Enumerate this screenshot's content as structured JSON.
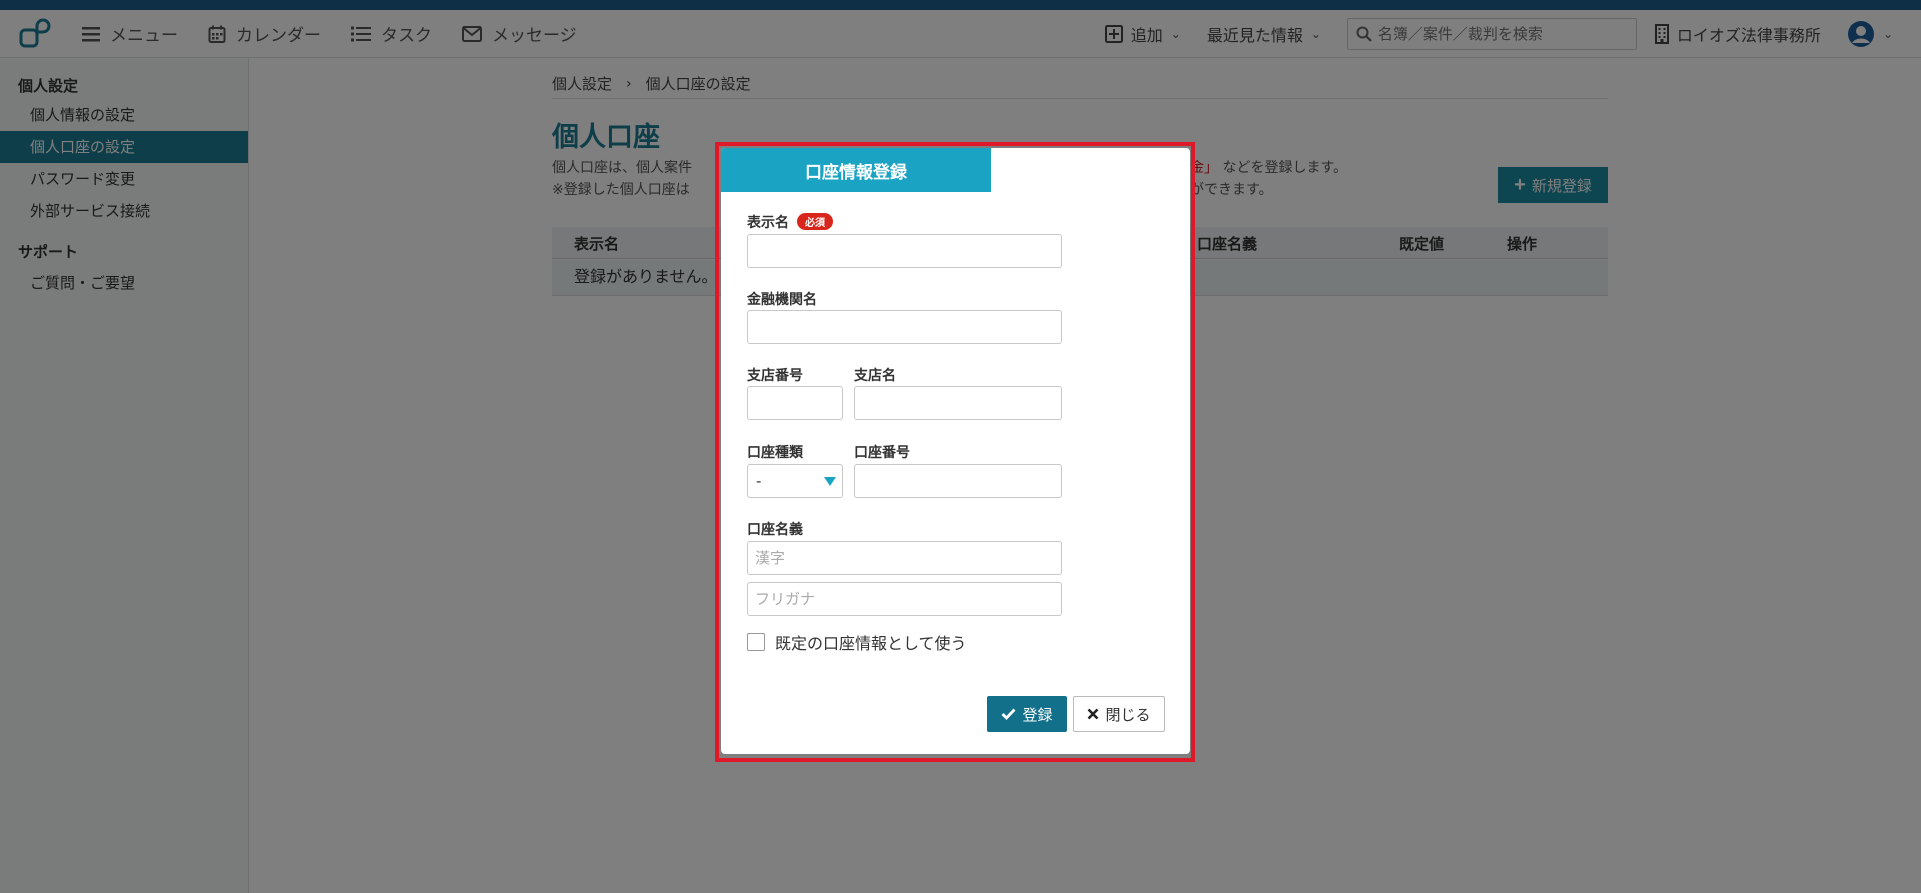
{
  "header": {
    "nav": [
      {
        "label": "メニュー",
        "icon": "menu-icon"
      },
      {
        "label": "カレンダー",
        "icon": "calendar-icon"
      },
      {
        "label": "タスク",
        "icon": "task-list-icon"
      },
      {
        "label": "メッセージ",
        "icon": "mail-icon"
      }
    ],
    "add_label": "追加",
    "recent_label": "最近見た情報",
    "search_placeholder": "名簿／案件／裁判を検索",
    "office_name": "ロイオズ法律事務所"
  },
  "sidebar": {
    "section1": "個人設定",
    "items1": [
      "個人情報の設定",
      "個人口座の設定",
      "パスワード変更",
      "外部サービス接続"
    ],
    "active_index": 1,
    "section2": "サポート",
    "items2": [
      "ご質問・ご要望"
    ]
  },
  "main": {
    "breadcrumb": [
      "個人設定",
      "個人口座の設定"
    ],
    "title": "個人口座",
    "desc_line1": "個人口座は、個人案件",
    "desc_line2": "※登録した個人口座は",
    "desc_right_red": "金」",
    "desc_right_line1": "などを登録します。",
    "desc_right_line2": "ができます。",
    "new_button": "新規登録",
    "table_headers": [
      "表示名",
      "口座名義",
      "既定値",
      "操作"
    ],
    "empty_text": "登録がありません。"
  },
  "modal": {
    "title": "口座情報登録",
    "display_name_label": "表示名",
    "required_badge": "必須",
    "bank_label": "金融機関名",
    "branch_no_label": "支店番号",
    "branch_name_label": "支店名",
    "account_type_label": "口座種類",
    "account_type_value": "-",
    "account_no_label": "口座番号",
    "holder_label": "口座名義",
    "holder_kanji_placeholder": "漢字",
    "holder_kana_placeholder": "フリガナ",
    "default_checkbox_label": "既定の口座情報として使う",
    "submit_label": "登録",
    "close_label": "閉じる"
  },
  "colors": {
    "accent": "#1a7d92",
    "modal_header": "#1aa3c2",
    "submit": "#12708a",
    "required": "#d9261c",
    "highlight_frame": "#e0192a"
  }
}
